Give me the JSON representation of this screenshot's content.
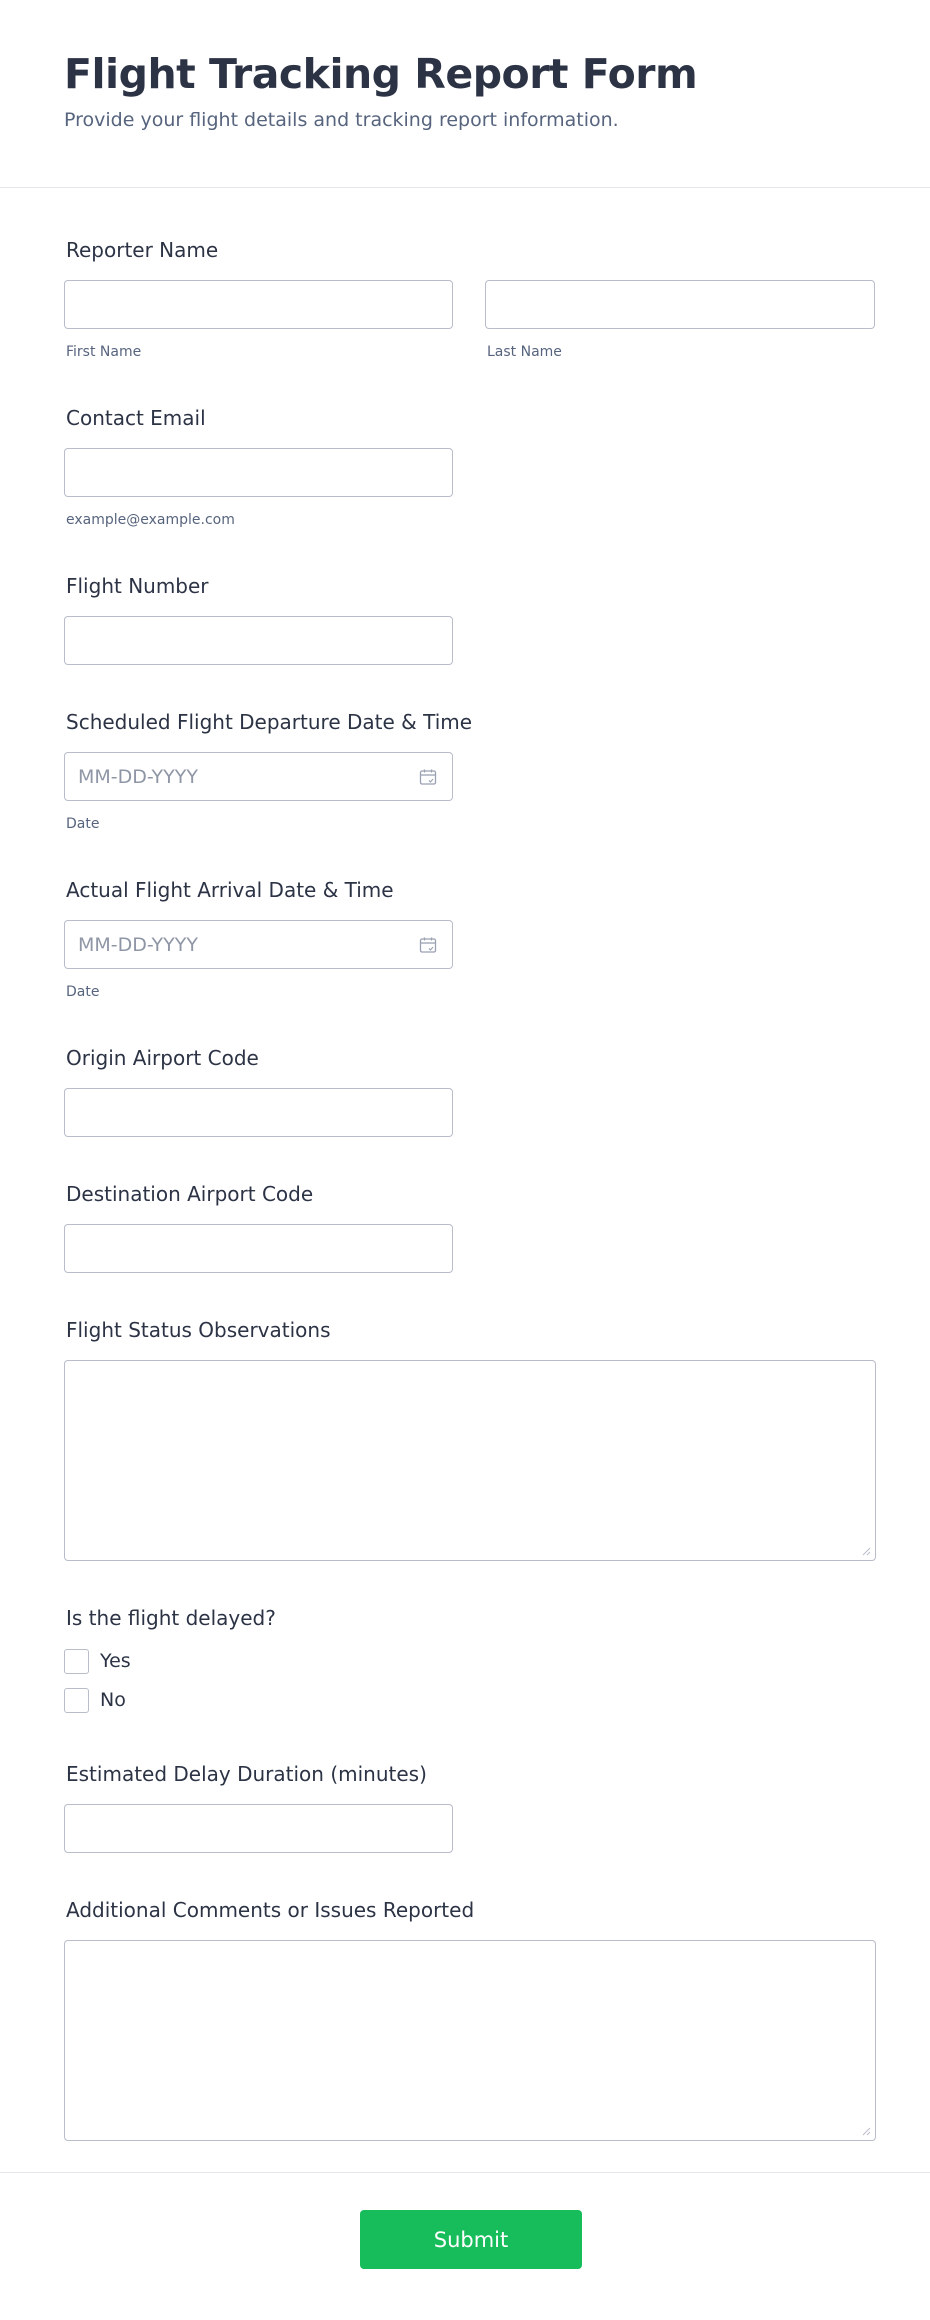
{
  "header": {
    "title": "Flight Tracking Report Form",
    "subtitle": "Provide your flight details and tracking report information."
  },
  "fields": {
    "reporter_name": {
      "label": "Reporter Name",
      "first_sublabel": "First Name",
      "last_sublabel": "Last Name",
      "first_value": "",
      "last_value": ""
    },
    "contact_email": {
      "label": "Contact Email",
      "sublabel": "example@example.com",
      "value": ""
    },
    "flight_number": {
      "label": "Flight Number",
      "value": ""
    },
    "departure": {
      "label": "Scheduled Flight Departure Date & Time",
      "placeholder": "MM-DD-YYYY",
      "sublabel": "Date",
      "icon": "calendar-icon"
    },
    "arrival": {
      "label": "Actual Flight Arrival Date & Time",
      "placeholder": "MM-DD-YYYY",
      "sublabel": "Date",
      "icon": "calendar-icon"
    },
    "origin_airport": {
      "label": "Origin Airport Code",
      "value": ""
    },
    "destination_airport": {
      "label": "Destination Airport Code",
      "value": ""
    },
    "status_observations": {
      "label": "Flight Status Observations",
      "value": ""
    },
    "delayed": {
      "label": "Is the flight delayed?",
      "options": [
        {
          "label": "Yes",
          "checked": false
        },
        {
          "label": "No",
          "checked": false
        }
      ]
    },
    "delay_duration": {
      "label": "Estimated Delay Duration (minutes)",
      "value": ""
    },
    "additional_comments": {
      "label": "Additional Comments or Issues Reported",
      "value": ""
    }
  },
  "footer": {
    "submit_label": "Submit"
  },
  "colors": {
    "accent": "#18bd5b",
    "text": "#2c3345",
    "subtext": "#57647e",
    "border": "#b8bdc9"
  }
}
